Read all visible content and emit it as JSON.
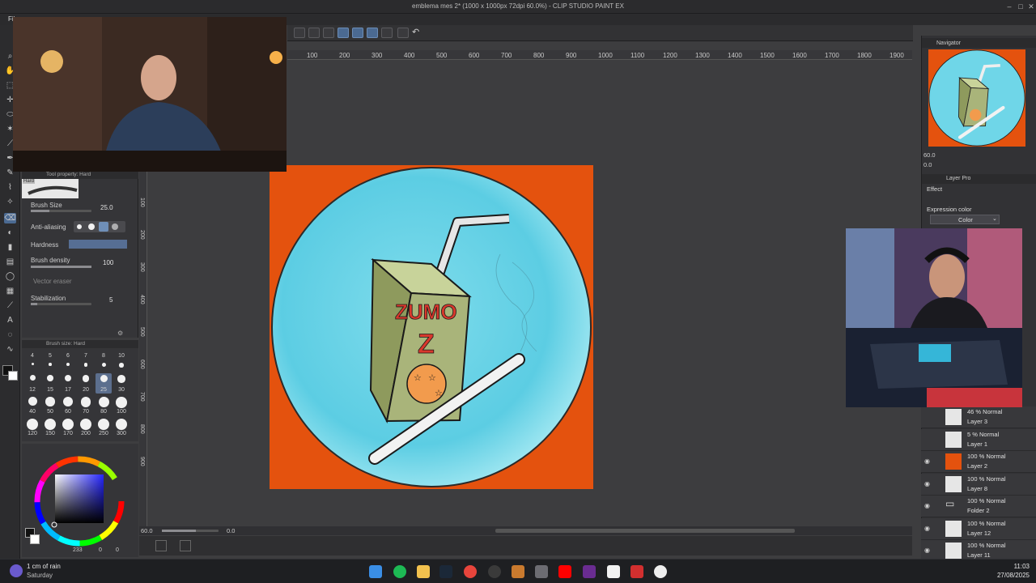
{
  "window": {
    "title": "emblema mes 2* (1000 x 1000px 72dpi 60.0%) - CLIP STUDIO PAINT EX",
    "menu_label": "Fil"
  },
  "ruler": {
    "h_ticks": [
      "100",
      "200",
      "300",
      "400",
      "500",
      "600",
      "700",
      "800",
      "900",
      "1000",
      "1100",
      "1200",
      "1300",
      "1400",
      "1500",
      "1600",
      "1700",
      "1800",
      "1900"
    ],
    "v_ticks": [
      "100",
      "200",
      "300",
      "400",
      "500",
      "600",
      "700",
      "800",
      "900"
    ]
  },
  "tool_property": {
    "header": "Tool property: Hard",
    "brush_name": "Hard",
    "brush_size_label": "Brush Size",
    "brush_size_value": "25.0",
    "anti_aliasing_label": "Anti-aliasing",
    "hardness_label": "Hardness",
    "brush_density_label": "Brush density",
    "brush_density_value": "100",
    "vector_eraser_label": "Vector eraser",
    "stabilization_label": "Stabilization",
    "stabilization_value": "5"
  },
  "brush_size_panel": {
    "header": "Brush size: Hard",
    "sizes": [
      "4",
      "5",
      "6",
      "7",
      "8",
      "10",
      "12",
      "15",
      "17",
      "20",
      "25",
      "30",
      "40",
      "50",
      "60",
      "70",
      "80",
      "100",
      "120",
      "150",
      "170",
      "200",
      "250",
      "300"
    ],
    "selected": "25"
  },
  "color_panel": {
    "values": [
      "233",
      "0",
      "0"
    ]
  },
  "canvas_status": {
    "zoom": "60.0",
    "angle": "0.0"
  },
  "artwork": {
    "box_text_line1": "ZUMO",
    "box_text_line2": "Z",
    "colors": {
      "background": "#e4520e",
      "bubble": "#6fd6e8",
      "box": "#a9b47a",
      "text": "#d8382c"
    }
  },
  "navigator": {
    "title": "Navigator",
    "zoom": "60.0",
    "angle": "0.0"
  },
  "layer_property": {
    "title": "Layer Pro",
    "effect_label": "Effect",
    "expression_color_label": "Expression color",
    "expression_color_value": "Color"
  },
  "layers": [
    {
      "mode": "46 % Normal",
      "name": "Layer 3",
      "visible": false,
      "thumb": "#e6e6e6"
    },
    {
      "mode": "5 % Normal",
      "name": "Layer 1",
      "visible": false,
      "thumb": "#e6e6e6"
    },
    {
      "mode": "100 % Normal",
      "name": "Layer 2",
      "visible": true,
      "thumb": "#e4520e"
    },
    {
      "mode": "100 % Normal",
      "name": "Layer 8",
      "visible": true,
      "thumb": "#e6e6e6"
    },
    {
      "mode": "100 % Normal",
      "name": "Folder 2",
      "visible": true,
      "thumb": "folder"
    },
    {
      "mode": "100 % Normal",
      "name": "Layer 12",
      "visible": true,
      "thumb": "#e6e6e6"
    },
    {
      "mode": "100 % Normal",
      "name": "Layer 11",
      "visible": true,
      "thumb": "#e6e6e6"
    }
  ],
  "taskbar": {
    "weather": "1 cm of rain",
    "day": "Saturday",
    "time": "11:03",
    "date": "27/08/2025",
    "apps": [
      "windows-start",
      "spotify",
      "file-explorer",
      "steam",
      "chrome",
      "obs",
      "clip-studio",
      "todo",
      "youtube",
      "nzxt",
      "clip-studio-paint",
      "movie-maker",
      "media-player"
    ]
  }
}
